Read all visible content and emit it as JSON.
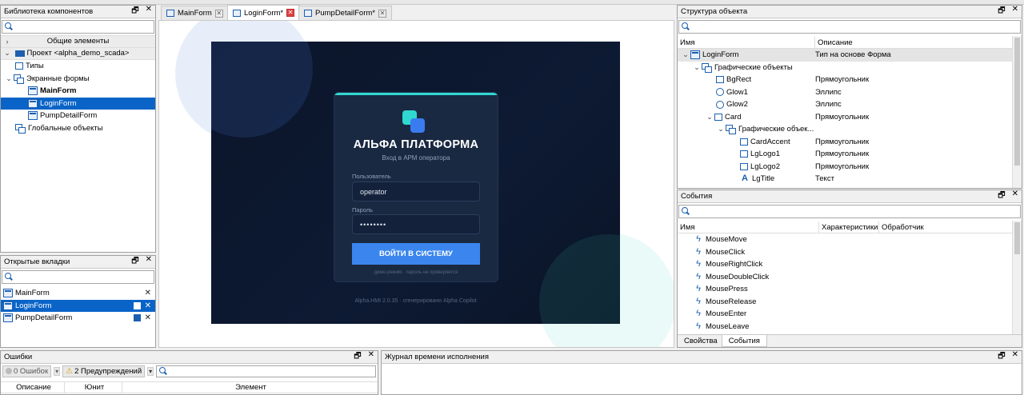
{
  "lib": {
    "title": "Библиотека компонентов",
    "common": "Общие элементы",
    "project": "Проект <alpha_demo_scada>",
    "types": "Типы",
    "screens": "Экранные формы",
    "forms": [
      "MainForm",
      "LoginForm",
      "PumpDetailForm"
    ],
    "globals": "Глобальные объекты"
  },
  "opentabs": {
    "title": "Открытые вкладки",
    "items": [
      "MainForm",
      "LoginForm",
      "PumpDetailForm"
    ]
  },
  "doc_tabs": [
    {
      "label": "MainForm"
    },
    {
      "label": "LoginForm*"
    },
    {
      "label": "PumpDetailForm*"
    }
  ],
  "structure": {
    "title": "Структура объекта",
    "col_name": "Имя",
    "col_desc": "Описание",
    "rows": [
      {
        "name": "LoginForm",
        "desc": "Тип на основе Форма"
      },
      {
        "name": "Графические объекты",
        "desc": ""
      },
      {
        "name": "BgRect",
        "desc": "Прямоугольник"
      },
      {
        "name": "Glow1",
        "desc": "Эллипс"
      },
      {
        "name": "Glow2",
        "desc": "Эллипс"
      },
      {
        "name": "Card",
        "desc": "Прямоугольник"
      },
      {
        "name": "Графические объек...",
        "desc": ""
      },
      {
        "name": "CardAccent",
        "desc": "Прямоугольник"
      },
      {
        "name": "LgLogo1",
        "desc": "Прямоугольник"
      },
      {
        "name": "LgLogo2",
        "desc": "Прямоугольник"
      },
      {
        "name": "LgTitle",
        "desc": "Текст"
      }
    ]
  },
  "events": {
    "title": "События",
    "col_name": "Имя",
    "col_props": "Характеристики",
    "col_handler": "Обработчик",
    "items": [
      "MouseMove",
      "MouseClick",
      "MouseRightClick",
      "MouseDoubleClick",
      "MousePress",
      "MouseRelease",
      "MouseEnter",
      "MouseLeave"
    ],
    "tab_props": "Свойства",
    "tab_events": "События"
  },
  "errors": {
    "title": "Ошибки",
    "errors_btn": "0 Ошибок",
    "warnings_btn": "2 Предупреждений",
    "col_desc": "Описание",
    "col_unit": "Юнит",
    "col_elem": "Элемент"
  },
  "runtime": {
    "title": "Журнал времени исполнения"
  },
  "login": {
    "title": "АЛЬФА ПЛАТФОРМА",
    "subtitle": "Вход в АРМ оператора",
    "user_label": "Пользователь",
    "user_value": "operator",
    "pass_label": "Пароль",
    "pass_value": "••••••••",
    "button": "ВОЙТИ В СИСТЕМУ",
    "demo_note": "демо-режим · пароль не проверяется",
    "footer": "Alpha.HMI 2.0.35 · сгенерировано Alpha Copilot"
  }
}
